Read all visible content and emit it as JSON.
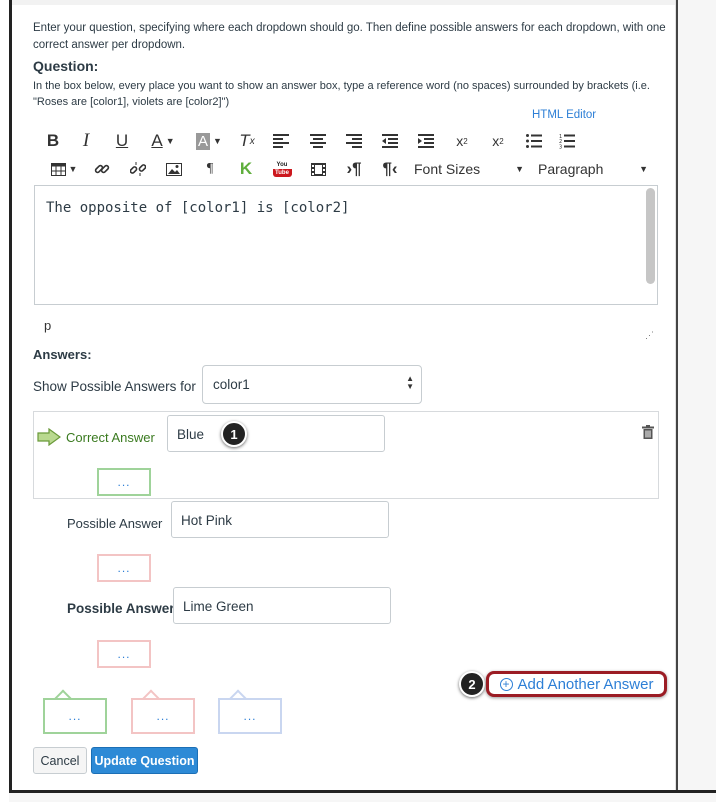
{
  "intro_text": "Enter your question, specifying where each dropdown should go. Then define possible answers for each dropdown, with one correct answer per dropdown.",
  "question": {
    "label": "Question:",
    "help_text": "In the box below, every place you want to show an answer box, type a reference word (no spaces) surrounded by brackets (i.e. \"Roses are [color1], violets are [color2]\")",
    "html_editor_link": "HTML Editor"
  },
  "toolbar": {
    "row1": [
      "bold-icon",
      "italic-icon",
      "underline-icon",
      "text-color-icon",
      "background-color-icon",
      "clear-formatting-icon",
      "align-left-icon",
      "align-center-icon",
      "align-right-icon",
      "outdent-icon",
      "indent-icon",
      "superscript-icon",
      "subscript-icon",
      "bullet-list-icon",
      "numbered-list-icon"
    ],
    "row2": [
      "table-icon",
      "link-icon",
      "unlink-icon",
      "image-icon",
      "pilcrow-icon",
      "kaltura-icon",
      "youtube-icon",
      "media-icon",
      "ltr-icon",
      "rtl-icon"
    ],
    "font_sizes_label": "Font Sizes",
    "paragraph_label": "Paragraph",
    "youtube_top": "You",
    "youtube_bottom": "Tube"
  },
  "editor": {
    "content": "The opposite of [color1] is [color2]",
    "path": "p"
  },
  "answers": {
    "label": "Answers:",
    "show_for_label": "Show Possible Answers for",
    "selected_blank": "color1",
    "correct_label": "Correct Answer",
    "correct_value": "Blue",
    "possible_label": "Possible Answer",
    "possible_values": [
      "Hot Pink",
      "Lime Green"
    ],
    "dots": "...",
    "add_another_label": "Add Another Answer"
  },
  "callouts": [
    "1",
    "2"
  ],
  "buttons": {
    "cancel": "Cancel",
    "update": "Update Question"
  },
  "colors": {
    "link_blue": "#2d7fd6",
    "correct_green": "#3a7a1f",
    "update_blue": "#2d8ad6",
    "highlight_red": "#9b1c24"
  }
}
